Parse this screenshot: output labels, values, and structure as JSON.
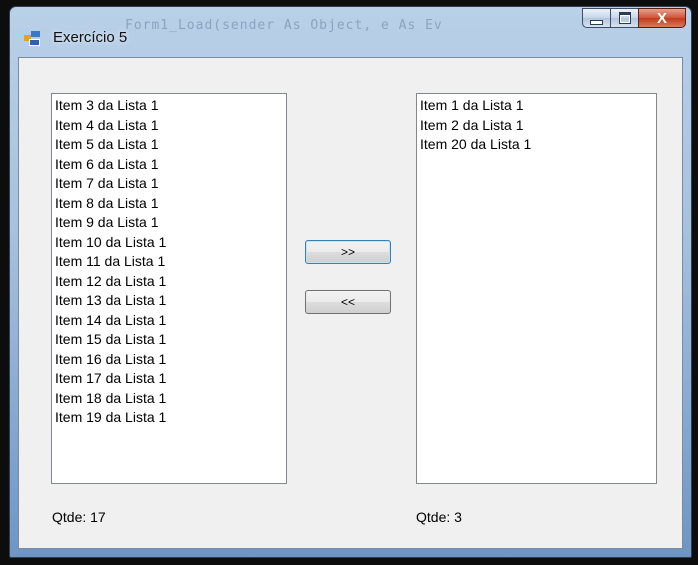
{
  "window": {
    "title": "Exercício 5",
    "background_code_text": "Form1_Load(sender As Object, e As Ev",
    "close_label": "X"
  },
  "left_list": {
    "items": [
      "Item 3 da Lista 1",
      "Item 4 da Lista 1",
      "Item 5 da Lista 1",
      "Item 6 da Lista 1",
      "Item 7 da Lista 1",
      "Item 8 da Lista 1",
      "Item 9 da Lista 1",
      "Item 10 da Lista 1",
      "Item 11 da Lista 1",
      "Item 12 da Lista 1",
      "Item 13 da Lista 1",
      "Item 14 da Lista 1",
      "Item 15 da Lista 1",
      "Item 16 da Lista 1",
      "Item 17 da Lista 1",
      "Item 18 da Lista 1",
      "Item 19 da Lista 1"
    ],
    "count_label": "Qtde: 17"
  },
  "right_list": {
    "items": [
      "Item 1 da Lista 1",
      "Item 2 da Lista 1",
      "Item 20 da Lista 1"
    ],
    "count_label": "Qtde: 3"
  },
  "buttons": {
    "move_right_label": ">>",
    "move_left_label": "<<"
  },
  "colors": {
    "titlebar_blue": "#a7c2df",
    "close_red": "#c13a1f",
    "client_bg": "#f0f0f0"
  }
}
